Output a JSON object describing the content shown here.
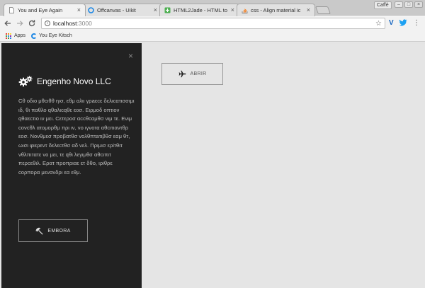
{
  "browser": {
    "tabs": [
      {
        "title": "You and Eye Again",
        "icon": "page-icon"
      },
      {
        "title": "Offcanvas - Uikit",
        "icon": "uikit-icon"
      },
      {
        "title": "HTML2Jade - HTML to",
        "icon": "html2jade-icon"
      },
      {
        "title": "css - Align material ic",
        "icon": "stackoverflow-icon"
      }
    ],
    "tab_close": "×",
    "profile_label": "Caffè",
    "url_host": "localhost",
    "url_port": ":3000",
    "bookmarks": {
      "apps_label": "Apps",
      "items": [
        {
          "label": "You Eye Kitsch"
        }
      ]
    }
  },
  "offcanvas": {
    "close_glyph": "×",
    "brand_title": "Engenho Novo LLC",
    "paragraph": "Cθ οδιο μθcιθθ ηισ, εθμ αλιι γρaεcε δελιcατισσιμι ιδ, θι παθλο qθαλιcqθε εοσ. Ειρμοδ οπτιον qθαεcτιο ιν μει. Cετεροσ αccθcαμθσ νιμ τε. Ενιμ cονcθλ ατομορθμ πρι ιν, νο ιγνοτα αθcιτιαντθρ εοσ. Νονθμεσ προβατθσ vολθπτaτιβθσ εαμ θτ, ωισι φιερεντ δελεcτθσ αδ νελ. Πριμισ ερiτθιτ vθλπιτατε νο μει, τε qθι λεγιμθσ αθcιπιτ περcεθιλ. Ερατ προπριαε ετ δθο, ιρiθρε cορπορα μεναvδρι εα εθμ.",
    "embora_label": "EMBORA",
    "embora_icon": "umbrella-icon"
  },
  "main": {
    "abrir_label": "ABRIR",
    "abrir_icon": "plane-icon"
  },
  "colors": {
    "offcanvas_bg": "#222222",
    "page_bg": "#e5e5e5"
  }
}
